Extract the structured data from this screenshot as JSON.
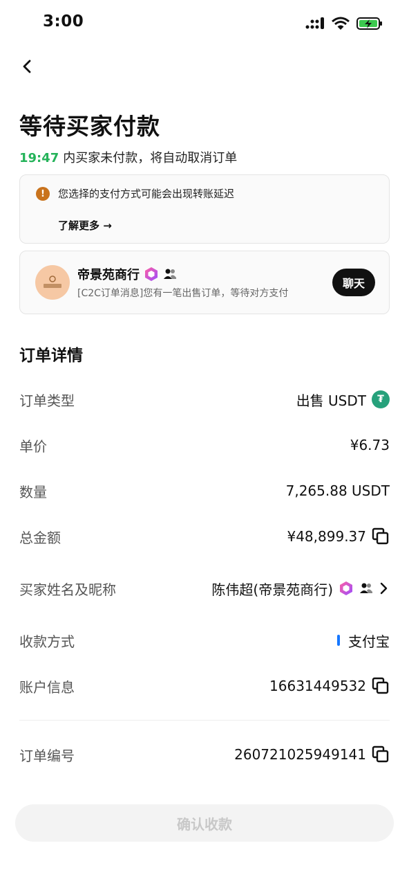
{
  "status_bar": {
    "time": "3:00"
  },
  "header": {
    "title": "等待买家付款"
  },
  "countdown": {
    "timer": "19:47",
    "text": "内买家未付款，将自动取消订单"
  },
  "notice": {
    "text": "您选择的支付方式可能会出现转账延迟",
    "link": "了解更多 →"
  },
  "chat_card": {
    "merchant_name": "帝景苑商行",
    "message": "[C2C订单消息]您有一笔出售订单，等待对方支付",
    "chat_button": "聊天"
  },
  "order_details": {
    "title": "订单详情",
    "rows": [
      {
        "label": "订单类型",
        "value": "出售 USDT"
      },
      {
        "label": "单价",
        "value": "¥6.73"
      },
      {
        "label": "数量",
        "value": "7,265.88 USDT"
      },
      {
        "label": "总金额",
        "value": "¥48,899.37"
      },
      {
        "label": "买家姓名及昵称",
        "value": "陈伟超(帝景苑商行)"
      },
      {
        "label": "收款方式",
        "value": "支付宝"
      },
      {
        "label": "账户信息",
        "value": "16631449532"
      },
      {
        "label": "订单编号",
        "value": "260721025949141"
      }
    ]
  },
  "footer": {
    "confirm_button": "确认收款"
  },
  "colors": {
    "timer_green": "#25b35a",
    "usdt_green": "#26a17b",
    "alipay_blue": "#1677ff",
    "warning_orange": "#c9731d"
  },
  "icons": [
    "back-arrow-icon",
    "warning-icon",
    "verified-badge-icon",
    "user-group-icon",
    "usdt-icon",
    "copy-icon",
    "chevron-right-icon"
  ]
}
